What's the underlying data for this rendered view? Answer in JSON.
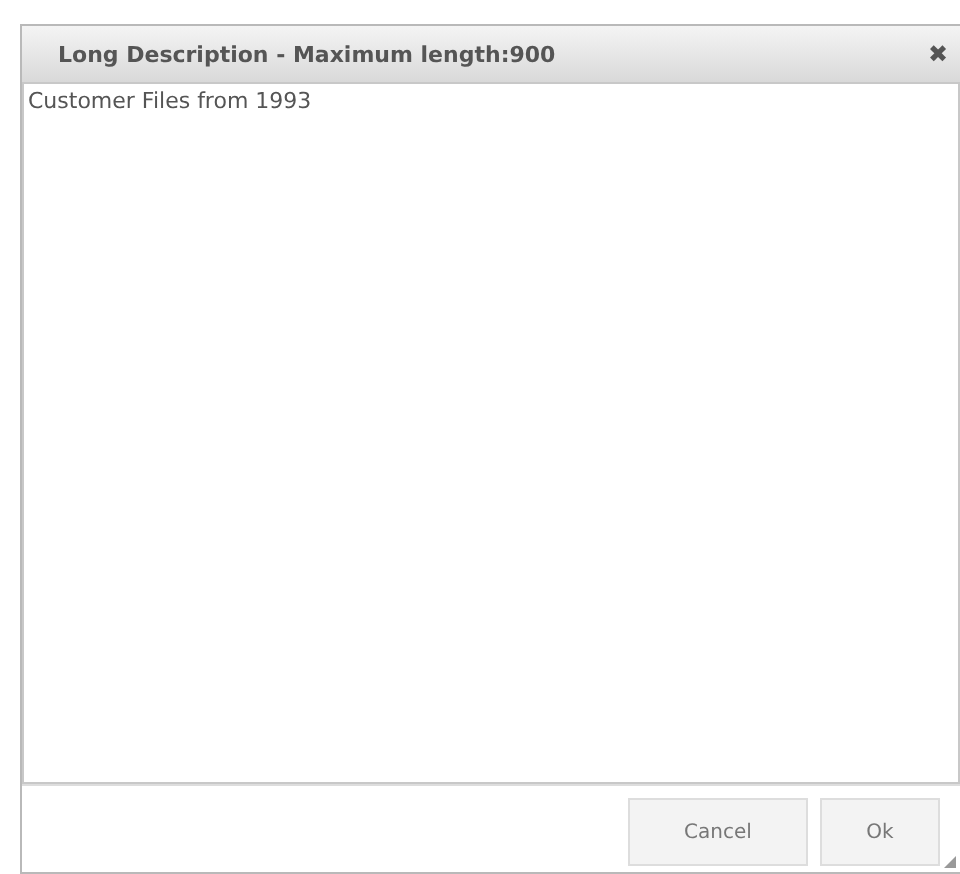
{
  "dialog": {
    "title": "Long Description - Maximum length:900",
    "close_label": "✖",
    "value": "Customer Files from 1993",
    "buttons": [
      {
        "label": "Cancel"
      },
      {
        "label": "Ok"
      }
    ]
  }
}
